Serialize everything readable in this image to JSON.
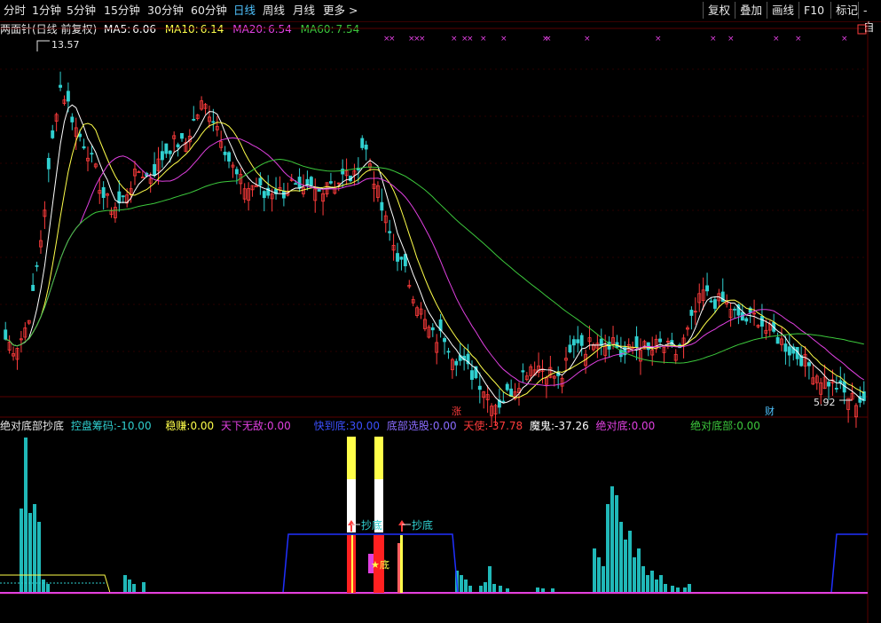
{
  "toolbar": {
    "tabs": [
      "分时",
      "1分钟",
      "5分钟",
      "15分钟",
      "30分钟",
      "60分钟",
      "日线",
      "周线",
      "月线",
      "更多 >"
    ],
    "active_tab": "日线",
    "right_buttons": [
      "复权",
      "叠加",
      "画线",
      "F10",
      "标记",
      "-自"
    ]
  },
  "colors": {
    "up": "#ff3c3c",
    "down": "#30d0d0",
    "ma5": "#ffffff",
    "ma10": "#ffff4a",
    "ma20": "#e040e0",
    "ma60": "#3cc83c"
  },
  "main_header": {
    "name": "两面针(日线 前复权)",
    "ma5_label": "MA5:",
    "ma5": "6.06",
    "ma10_label": "MA10:",
    "ma10": "6.14",
    "ma20_label": "MA20:",
    "ma20": "6.54",
    "ma60_label": "MA60:",
    "ma60": "7.54"
  },
  "annotations": {
    "high": "13.57",
    "low": "5.92",
    "zhang": "涨",
    "cai": "财",
    "chaodi1": "抄底",
    "chaodi2": "抄底",
    "di": "底",
    "star": "★"
  },
  "indicator_header": {
    "title": "绝对底部抄底",
    "kp_label": "控盘筹码:",
    "kp": "-10.00",
    "wz_label": "稳赚:",
    "wz": "0.00",
    "txwd_label": "天下无敌:",
    "txwd": "0.00",
    "kdd_label": "快到底:",
    "kdd": "30.00",
    "dbxg_label": "底部选股:",
    "dbxg": "0.00",
    "ts_label": "天使:",
    "ts": "-37.78",
    "mg_label": "魔鬼:",
    "mg": "-37.26",
    "jdd_label": "绝对底:",
    "jdd": "0.00",
    "jddb_label": "绝对底部:",
    "jddb": "0.00"
  },
  "chart_data": {
    "type": "candlestick",
    "price_high": 13.57,
    "price_low": 5.92,
    "last_ma": {
      "MA5": 6.06,
      "MA10": 6.14,
      "MA20": 6.54,
      "MA60": 7.54
    },
    "indicator_last": {
      "控盘筹码": -10.0,
      "稳赚": 0.0,
      "天下无敌": 0.0,
      "快到底": 30.0,
      "底部选股": 0.0,
      "天使": -37.78,
      "魔鬼": -37.26,
      "绝对底": 0.0,
      "绝对底部": 0.0
    },
    "close_path": [
      7.2,
      7.0,
      7.3,
      8.0,
      9.4,
      11.0,
      12.6,
      12.2,
      11.6,
      11.3,
      10.8,
      10.2,
      10.0,
      10.1,
      10.5,
      10.8,
      10.6,
      10.9,
      11.2,
      11.4,
      11.3,
      11.8,
      12.2,
      12.0,
      11.6,
      11.0,
      10.6,
      10.4,
      10.5,
      10.2,
      10.4,
      10.3,
      10.5,
      10.2,
      10.4,
      10.3,
      10.6,
      10.5,
      10.7,
      10.6,
      11.4,
      10.8,
      10.0,
      9.4,
      8.9,
      8.5,
      8.0,
      7.5,
      7.2,
      7.3,
      6.9,
      6.7,
      6.5,
      6.3,
      6.0,
      5.8,
      6.0,
      6.2,
      6.5,
      6.7,
      6.6,
      6.5,
      6.3,
      6.8,
      7.2,
      7.0,
      7.3,
      7.1,
      7.2,
      6.8,
      7.0,
      7.1,
      6.9,
      7.1,
      7.0,
      6.9,
      7.2,
      7.7,
      8.2,
      8.0,
      8.0,
      7.9,
      7.6,
      7.6,
      7.7,
      7.4,
      7.3,
      7.1,
      6.9,
      6.8,
      6.6,
      6.4,
      6.3,
      6.2,
      6.0,
      5.9,
      5.92
    ]
  }
}
